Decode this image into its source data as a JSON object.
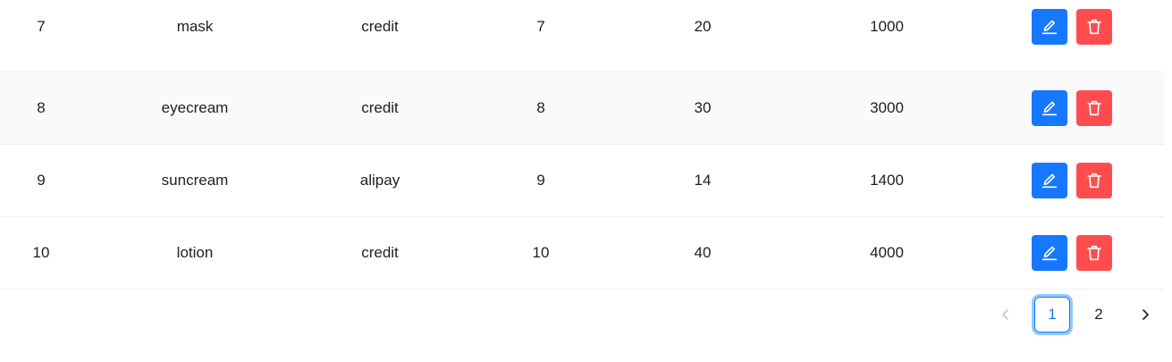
{
  "table": {
    "rows": [
      {
        "id": "7",
        "name": "mask",
        "payment": "credit",
        "qty": "7",
        "price": "20",
        "total": "1000"
      },
      {
        "id": "8",
        "name": "eyecream",
        "payment": "credit",
        "qty": "8",
        "price": "30",
        "total": "3000"
      },
      {
        "id": "9",
        "name": "suncream",
        "payment": "alipay",
        "qty": "9",
        "price": "14",
        "total": "1400"
      },
      {
        "id": "10",
        "name": "lotion",
        "payment": "credit",
        "qty": "10",
        "price": "40",
        "total": "4000"
      }
    ]
  },
  "actions": {
    "edit_icon": "edit-pencil-icon",
    "delete_icon": "trash-icon"
  },
  "pagination": {
    "pages": [
      "1",
      "2"
    ],
    "current": "1",
    "prev_icon": "chevron-left-icon",
    "next_icon": "chevron-right-icon"
  },
  "colors": {
    "primary": "#1677ff",
    "danger": "#ff4d4f",
    "stripe": "#fafafa"
  }
}
